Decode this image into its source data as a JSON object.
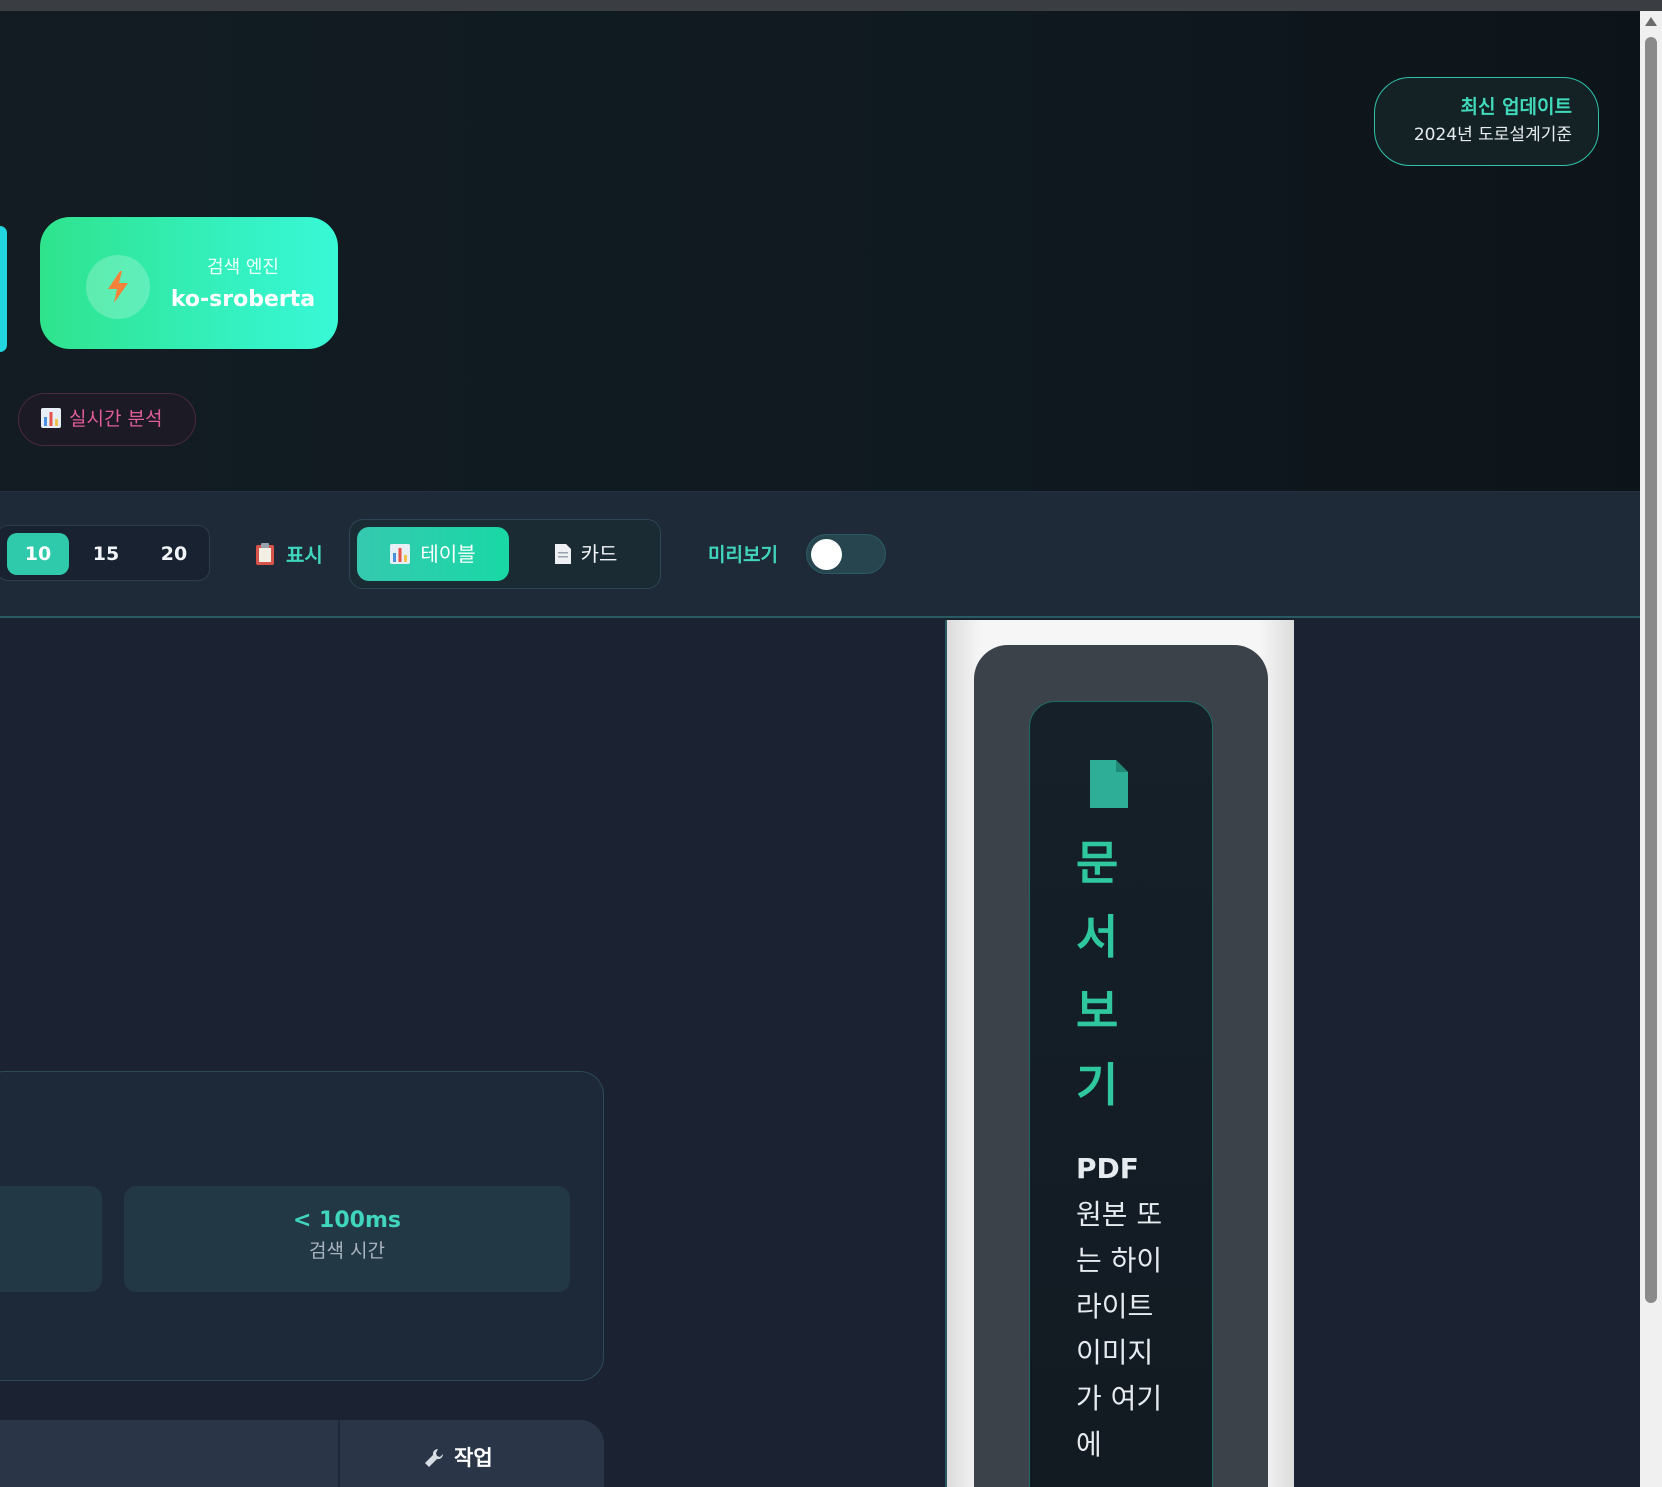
{
  "header": {
    "update_badge": {
      "title": "최신 업데이트",
      "subtitle": "2024년 도로설계기준"
    },
    "engine_card": {
      "label": "검색 엔진",
      "value": "ko-sroberta",
      "icon": "lightning-icon"
    },
    "live_pill": {
      "label": "실시간 분석",
      "icon": "bar-chart-icon"
    }
  },
  "toolbar": {
    "counts": [
      "10",
      "15",
      "20"
    ],
    "selected_count": "10",
    "show_label": "표시",
    "view_options": {
      "table": "테이블",
      "card": "카드"
    },
    "selected_view": "테이블",
    "preview_label": "미리보기",
    "preview_toggle_on": false
  },
  "stats": {
    "search_time_value": "< 100ms",
    "search_time_label": "검색 시간"
  },
  "table": {
    "action_header": "작업"
  },
  "preview_panel": {
    "title": "문서보기",
    "desc_strong": "PDF",
    "desc": " 원본 또는 하이라이트 이미지가 여기에"
  },
  "colors": {
    "accent": "#3fd6bd",
    "engine_gradient_start": "#2fe38c",
    "engine_gradient_end": "#38f8d6",
    "live_pink": "#e05c9a"
  }
}
